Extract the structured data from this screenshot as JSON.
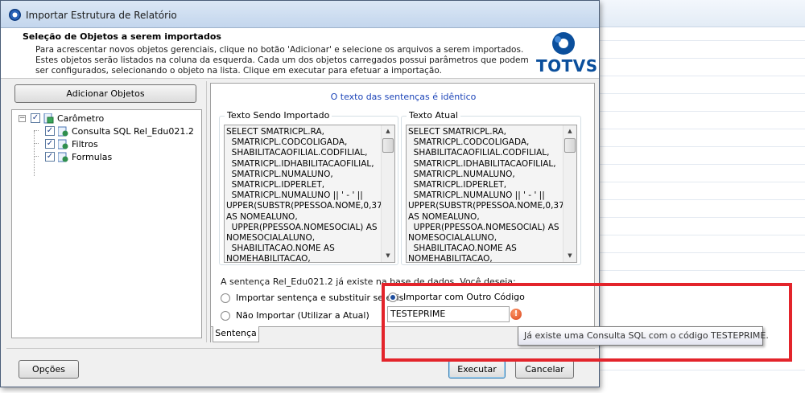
{
  "dialog": {
    "title": "Importar Estrutura de Relatório",
    "header_title": "Seleção de Objetos a serem importados",
    "description": [
      "Para acrescentar novos objetos gerenciais, clique no botão 'Adicionar' e selecione os arquivos a serem importados.",
      "Estes objetos serão listados na coluna da esquerda. Cada um dos objetos carregados possui parâmetros que podem",
      "ser configurados, selecionando o objeto na lista. Clique em executar para efetuar a importação."
    ],
    "logo_text": "TOTVS"
  },
  "left_pane": {
    "add_button": "Adicionar Objetos",
    "tree": {
      "root": "Carômetro",
      "children": [
        "Consulta SQL Rel_Edu021.2",
        "Filtros",
        "Formulas"
      ]
    }
  },
  "right_pane": {
    "compare_message": "O texto das sentenças é idêntico",
    "imported_legend": "Texto Sendo Importado",
    "current_legend": "Texto Atual",
    "sql_imported": "SELECT SMATRICPL.RA,\n  SMATRICPL.CODCOLIGADA,\n  SHABILITACAOFILIAL.CODFILIAL,\n  SMATRICPL.IDHABILITACAOFILIAL,\n  SMATRICPL.NUMALUNO,\n  SMATRICPL.IDPERLET,\n  SMATRICPL.NUMALUNO || ' - ' ||\nUPPER(SUBSTR(PPESSOA.NOME,0,37))\nAS NOMEALUNO,\n  UPPER(PPESSOA.NOMESOCIAL) AS\nNOMESOCIALALUNO,\n  SHABILITACAO.NOME AS\nNOMEHABILITACAO,",
    "sql_current": "SELECT SMATRICPL.RA,\n  SMATRICPL.CODCOLIGADA,\n  SHABILITACAOFILIAL.CODFILIAL,\n  SMATRICPL.IDHABILITACAOFILIAL,\n  SMATRICPL.NUMALUNO,\n  SMATRICPL.IDPERLET,\n  SMATRICPL.NUMALUNO || ' - ' ||\nUPPER(SUBSTR(PPESSOA.NOME,0,37))\nAS NOMEALUNO,\n  UPPER(PPESSOA.NOMESOCIAL) AS\nNOMESOCIALALUNO,\n  SHABILITACAO.NOME AS\nNOMEHABILITACAO,",
    "question": "A sentença Rel_Edu021.2 já existe na base de dados. Você deseja:",
    "options": {
      "replace": "Importar sentença e substituir se existir",
      "no_import": "Não Importar (Utilizar a Atual)",
      "other_code": "Importar com Outro Código"
    },
    "selected_option": "other_code",
    "code_value": "TESTEPRIME",
    "tab_label": "Sentença"
  },
  "tooltip": "Já existe uma Consulta SQL com o código TESTEPRIME.",
  "buttons": {
    "options": "Opções",
    "execute": "Executar",
    "cancel": "Cancelar"
  },
  "colors": {
    "annotation": "#e3242b",
    "link_blue": "#1c44b8",
    "brand": "#0b4f9c"
  }
}
